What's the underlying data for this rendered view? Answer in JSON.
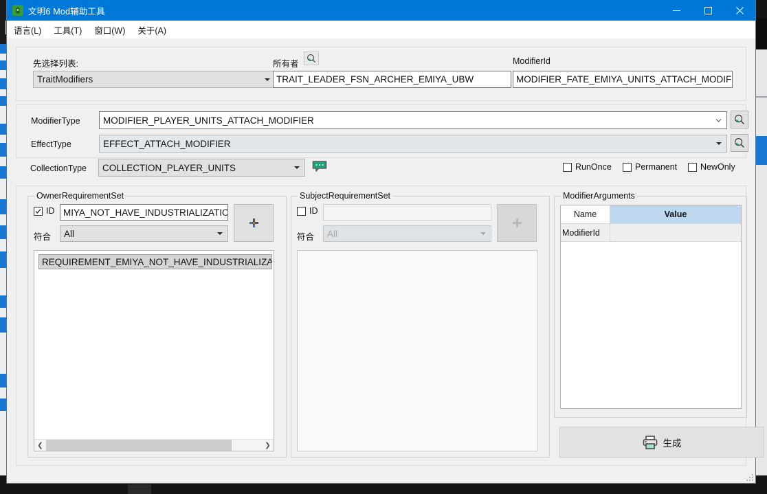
{
  "window": {
    "title": "文明6 Mod辅助工具",
    "app_icon": "app-icon",
    "minimize_label": "—",
    "maximize_label": "□",
    "close_label": "✕"
  },
  "menubar": {
    "items": [
      {
        "label": "语言(L)",
        "name": "menu-language"
      },
      {
        "label": "工具(T)",
        "name": "menu-tools"
      },
      {
        "label": "窗口(W)",
        "name": "menu-window"
      },
      {
        "label": "关于(A)",
        "name": "menu-about"
      }
    ]
  },
  "top_panel": {
    "list_label": "先选择列表:",
    "list_value": "TraitModifiers",
    "owner_label": "所有者",
    "owner_search_icon": "search-icon",
    "owner_value": "TRAIT_LEADER_FSN_ARCHER_EMIYA_UBW",
    "modifier_id_label": "ModifierId",
    "modifier_id_value": "MODIFIER_FATE_EMIYA_UNITS_ATTACH_MODIFIER"
  },
  "mid_panel": {
    "modifier_type_label": "ModifierType",
    "modifier_type_value": "MODIFIER_PLAYER_UNITS_ATTACH_MODIFIER",
    "modifier_type_search_icon": "search-icon",
    "effect_type_label": "EffectType",
    "effect_type_value": "EFFECT_ATTACH_MODIFIER",
    "effect_type_search_icon": "search-icon",
    "collection_type_label": "CollectionType",
    "collection_type_value": "COLLECTION_PLAYER_UNITS",
    "comment_icon": "speech-bubble-icon",
    "checkboxes": [
      {
        "label": "RunOnce",
        "checked": false,
        "name": "checkbox-runonce"
      },
      {
        "label": "Permanent",
        "checked": false,
        "name": "checkbox-permanent"
      },
      {
        "label": "NewOnly",
        "checked": false,
        "name": "checkbox-newonly"
      }
    ]
  },
  "owner_group": {
    "title": "OwnerRequirementSet",
    "id_label": "ID",
    "id_checked": true,
    "id_value": "MIYA_NOT_HAVE_INDUSTRIALIZATION",
    "match_label": "符合",
    "match_value": "All",
    "add_label": "+",
    "list_items": [
      "REQUIREMENT_EMIYA_NOT_HAVE_INDUSTRIALIZATIO"
    ],
    "scroll_left_icon": "chevron-left-icon",
    "scroll_right_icon": "chevron-right-icon"
  },
  "subject_group": {
    "title": "SubjectRequirementSet",
    "id_label": "ID",
    "id_checked": false,
    "id_value": "",
    "match_label": "符合",
    "match_value": "All",
    "add_label": "+",
    "list_items": []
  },
  "arguments_group": {
    "title": "ModifierArguments",
    "columns": [
      {
        "label": "Name",
        "selected": false
      },
      {
        "label": "Value",
        "selected": true
      }
    ],
    "rows": [
      {
        "name": "ModifierId",
        "value": ""
      }
    ]
  },
  "generate_button": {
    "label": "生成",
    "icon": "printer-icon"
  },
  "colors": {
    "titlebar": "#0078d7",
    "accent": "#1e8ad6",
    "grid_selected_header": "#bdd7ee",
    "icon_teal": "#1aa37a",
    "window_bg": "#f0f0f0"
  }
}
